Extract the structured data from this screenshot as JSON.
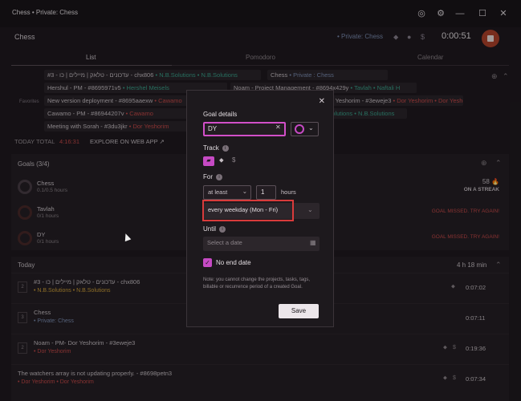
{
  "window": {
    "title": "Chess • Private: Chess"
  },
  "header": {
    "title": "Chess",
    "project": "• Private: Chess",
    "timer": "0:00:51"
  },
  "tabs": [
    {
      "label": "List"
    },
    {
      "label": "Pomodoro"
    },
    {
      "label": "Calendar"
    }
  ],
  "recent": {
    "favorites_label": "Favorites",
    "row1": {
      "a": "#3 - עדכונים - טלאק | מיילים | כו - chx806",
      "a_proj": "• N.B.Solutions",
      "a_client": "• N.B.Solutions",
      "b": "Chess",
      "b_proj": "• Private : Chess"
    },
    "row2": {
      "a": "Hershul - PM - #8695971v5",
      "a_proj": "• Hershel Meisels",
      "b": "Noam - Project Management - #8694x429y",
      "b_proj": "• Tavlah • Naftali H"
    },
    "row3": {
      "a": "New version deployment - #8695aaexw",
      "a_proj": "• Cawamo",
      "b": "Noam - PM - Dor Yeshorim - #3eweje3",
      "b_proj": "• Dor Yeshorim • Dor Yeshorim"
    },
    "row4": {
      "a": "Cawamo - PM - #86944207v",
      "a_proj": "• Cawamo",
      "b": "• N.B.Solutions • N.B.Solutions"
    },
    "row5": {
      "a": "Meeting with Sorah - #3du3jkr",
      "a_proj": "• Dor Yeshorim"
    }
  },
  "totals": {
    "label": "TODAY TOTAL",
    "value": "4:16:31",
    "explore": "EXPLORE ON WEB APP ↗"
  },
  "goals": {
    "header": "Goals (3/4)",
    "items": [
      {
        "name": "Chess",
        "sub": "0.1/0.5 hours",
        "streak_count": "58 🔥",
        "status": "ON A STREAK"
      },
      {
        "name": "Tavlah",
        "sub": "0/1 hours",
        "status": "GOAL MISSED. TRY AGAIN!"
      },
      {
        "name": "DY",
        "sub": "0/1 hours",
        "status": "GOAL MISSED. TRY AGAIN!"
      }
    ]
  },
  "today": {
    "header": "Today",
    "duration": "4 h 18 min",
    "entries": [
      {
        "num": "2",
        "title": "#3 - עדכונים - טלאק | מיילים | כו - chx806",
        "sub": "• N.B.Solutions  • N.B.Solutions",
        "dur": "0:07:02",
        "color": "#d1a23a"
      },
      {
        "num": "3",
        "title": "Chess",
        "sub": "• Private: Chess",
        "dur": "0:07:11",
        "color": "#7e8fb4"
      },
      {
        "num": "2",
        "title": "Noam - PM- Dor Yeshorim - #3eweje3",
        "sub": "• Dor Yeshorim",
        "dur": "0:19:36",
        "color": "#c94a4a"
      },
      {
        "num": "",
        "title": "The watchers array is not updating properly. - #8698petn3",
        "sub": "• Dor Yeshorim  • Dor Yeshorim",
        "dur": "0:07:34",
        "color": "#c94a4a"
      }
    ]
  },
  "modal": {
    "heading": "Goal details",
    "goal_name": "DY",
    "track_label": "Track",
    "for_label": "For",
    "operator": "at least",
    "amount": "1",
    "unit": "hours",
    "recurrence": "every weekday (Mon - Fri)",
    "until_label": "Until",
    "date_placeholder": "Select a date",
    "no_end_label": "No end date",
    "note": "Note: you cannot change the projects, tasks, tags, billable or recurrence period of a created Goal.",
    "save_label": "Save"
  },
  "colors": {
    "accent": "#c64ac4",
    "highlight": "#d93b3b",
    "danger": "#c94a4a",
    "success": "#3aa38c"
  }
}
